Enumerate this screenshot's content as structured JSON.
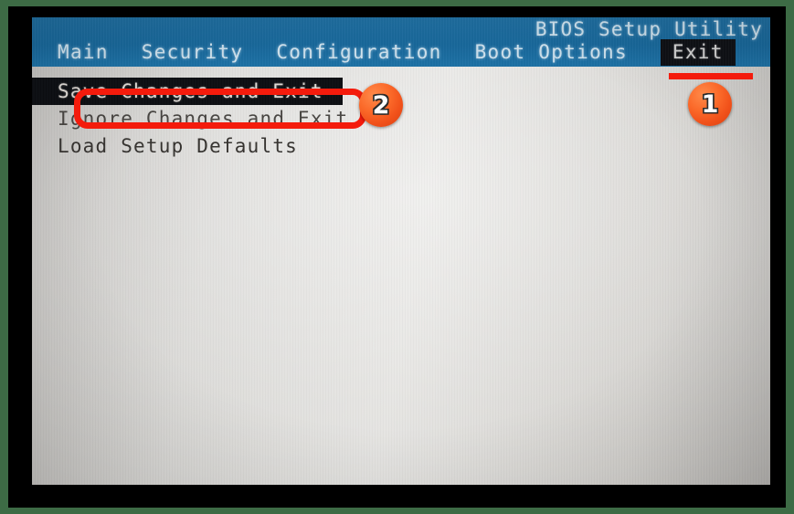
{
  "screen": {
    "title": "BIOS Setup Utility",
    "menu_tabs": [
      {
        "label": "Main",
        "selected": false
      },
      {
        "label": "Security",
        "selected": false
      },
      {
        "label": "Configuration",
        "selected": false
      },
      {
        "label": "Boot Options",
        "selected": false
      },
      {
        "label": "Exit",
        "selected": true
      }
    ],
    "options": [
      {
        "label": "Save Changes and Exit",
        "selected": true
      },
      {
        "label": "Ignore Changes and Exit",
        "selected": false
      },
      {
        "label": "Load Setup Defaults",
        "selected": false
      }
    ]
  },
  "annotations": {
    "badges": [
      {
        "number": "1",
        "target": "Exit tab"
      },
      {
        "number": "2",
        "target": "Save Changes and Exit"
      }
    ],
    "highlight_color": "#f41b0c",
    "badge_color": "#f1511a"
  },
  "colors": {
    "header_blue": "#15679c",
    "screen_gray": "#e2e1de",
    "selection_black": "#0c0e12",
    "photo_border_green": "#3d6b45",
    "bezel_black": "#000000"
  }
}
